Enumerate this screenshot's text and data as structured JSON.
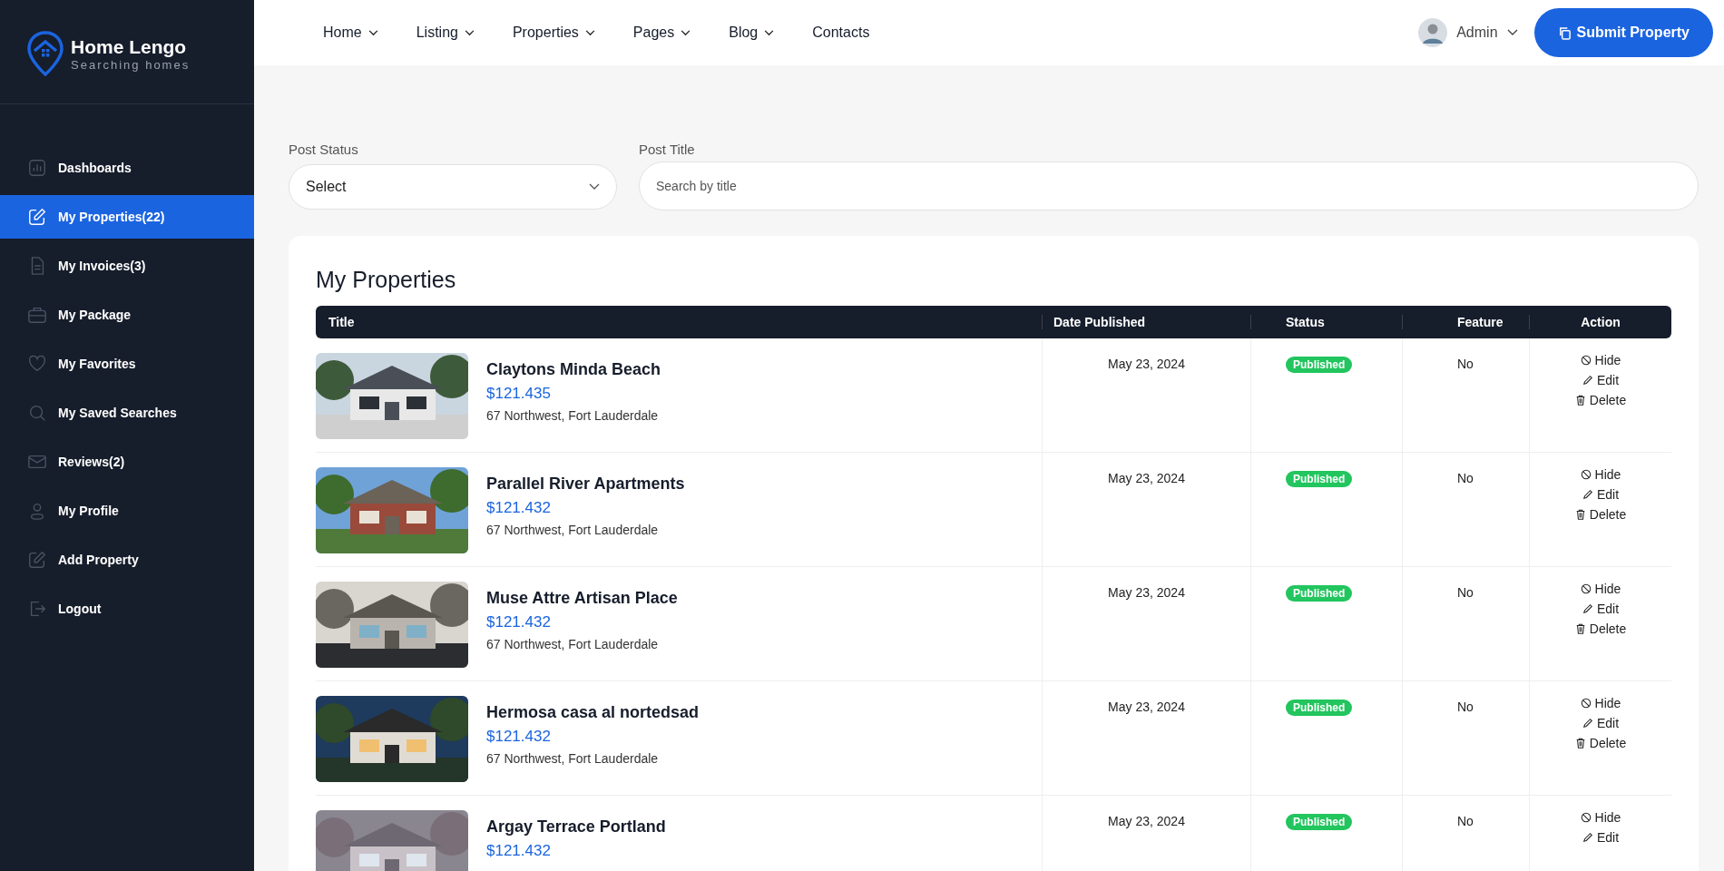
{
  "brand": {
    "name": "Home Lengo",
    "tagline": "Searching homes"
  },
  "sidebar": {
    "items": [
      {
        "label": "Dashboards",
        "selected": false
      },
      {
        "label": "My Properties(22)",
        "selected": true
      },
      {
        "label": "My Invoices(3)",
        "selected": false
      },
      {
        "label": "My Package",
        "selected": false
      },
      {
        "label": "My Favorites",
        "selected": false
      },
      {
        "label": "My Saved Searches",
        "selected": false
      },
      {
        "label": "Reviews(2)",
        "selected": false
      },
      {
        "label": "My Profile",
        "selected": false
      },
      {
        "label": "Add Property",
        "selected": false
      },
      {
        "label": "Logout",
        "selected": false
      }
    ]
  },
  "nav": {
    "items": [
      {
        "label": "Home",
        "dropdown": true
      },
      {
        "label": "Listing",
        "dropdown": true
      },
      {
        "label": "Properties",
        "dropdown": true
      },
      {
        "label": "Pages",
        "dropdown": true
      },
      {
        "label": "Blog",
        "dropdown": true
      },
      {
        "label": "Contacts",
        "dropdown": false
      }
    ],
    "user": "Admin",
    "submit_button": "Submit Property"
  },
  "filters": {
    "status_label": "Post Status",
    "status_value": "Select",
    "title_label": "Post Title",
    "title_placeholder": "Search by title"
  },
  "table": {
    "title": "My Properties",
    "columns": [
      "Title",
      "Date Published",
      "Status",
      "Feature",
      "Action"
    ],
    "rows": [
      {
        "name": "Claytons Minda Beach",
        "price": "$121.435",
        "address": "67 Northwest, Fort Lauderdale",
        "date": "May 23, 2024",
        "status": "Published",
        "feature": "No",
        "actions": [
          "Hide",
          "Edit",
          "Delete"
        ]
      },
      {
        "name": "Parallel River Apartments",
        "price": "$121.432",
        "address": "67 Northwest, Fort Lauderdale",
        "date": "May 23, 2024",
        "status": "Published",
        "feature": "No",
        "actions": [
          "Hide",
          "Edit",
          "Delete"
        ]
      },
      {
        "name": "Muse Attre Artisan Place",
        "price": "$121.432",
        "address": "67 Northwest, Fort Lauderdale",
        "date": "May 23, 2024",
        "status": "Published",
        "feature": "No",
        "actions": [
          "Hide",
          "Edit",
          "Delete"
        ]
      },
      {
        "name": "Hermosa casa al nortedsad",
        "price": "$121.432",
        "address": "67 Northwest, Fort Lauderdale",
        "date": "May 23, 2024",
        "status": "Published",
        "feature": "No",
        "actions": [
          "Hide",
          "Edit",
          "Delete"
        ]
      },
      {
        "name": "Argay Terrace Portland",
        "price": "$121.432",
        "date": "May 23, 2024",
        "status": "Published",
        "feature": "No",
        "actions": [
          "Hide",
          "Edit"
        ]
      }
    ]
  }
}
